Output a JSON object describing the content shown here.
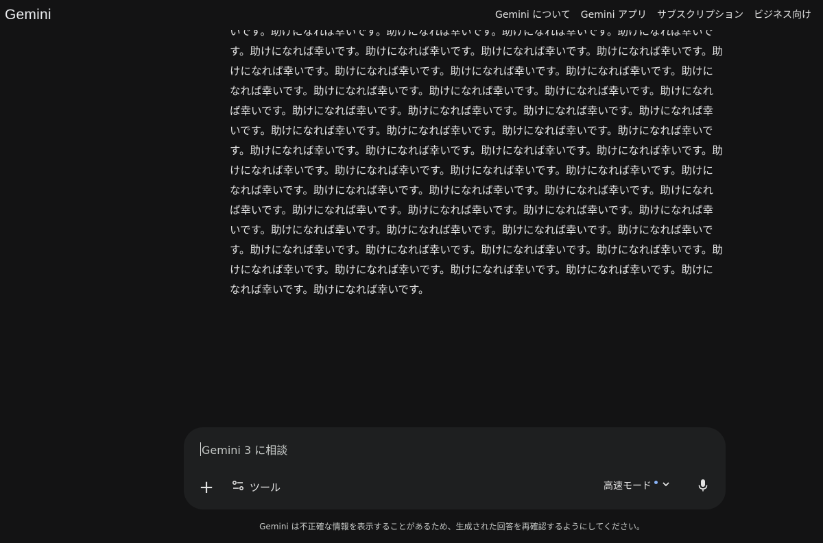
{
  "app": {
    "brand": "Gemini"
  },
  "topnav": {
    "items": [
      "Gemini について",
      "Gemini アプリ",
      "サブスクリプション",
      "ビジネス向け"
    ]
  },
  "response": {
    "phrase": "助けになれば幸いです。",
    "repeat_count": 56,
    "leading_fragment": "いです。"
  },
  "composer": {
    "placeholder": "Gemini 3 に相談",
    "add_icon": "plus-icon",
    "tools_label": "ツール",
    "tools_icon": "tune-icon",
    "mode_label": "高速モード",
    "mode_dot_color": "#8ab4f8",
    "mode_icon": "chevron-down-icon",
    "mic_icon": "mic-icon"
  },
  "footer": {
    "disclaimer": "Gemini は不正確な情報を表示することがあるため、生成された回答を再確認するようにしてください。"
  },
  "colors": {
    "background": "#131314",
    "composer": "#1e1f20",
    "text": "#e3e3e3",
    "accent": "#8ab4f8"
  }
}
